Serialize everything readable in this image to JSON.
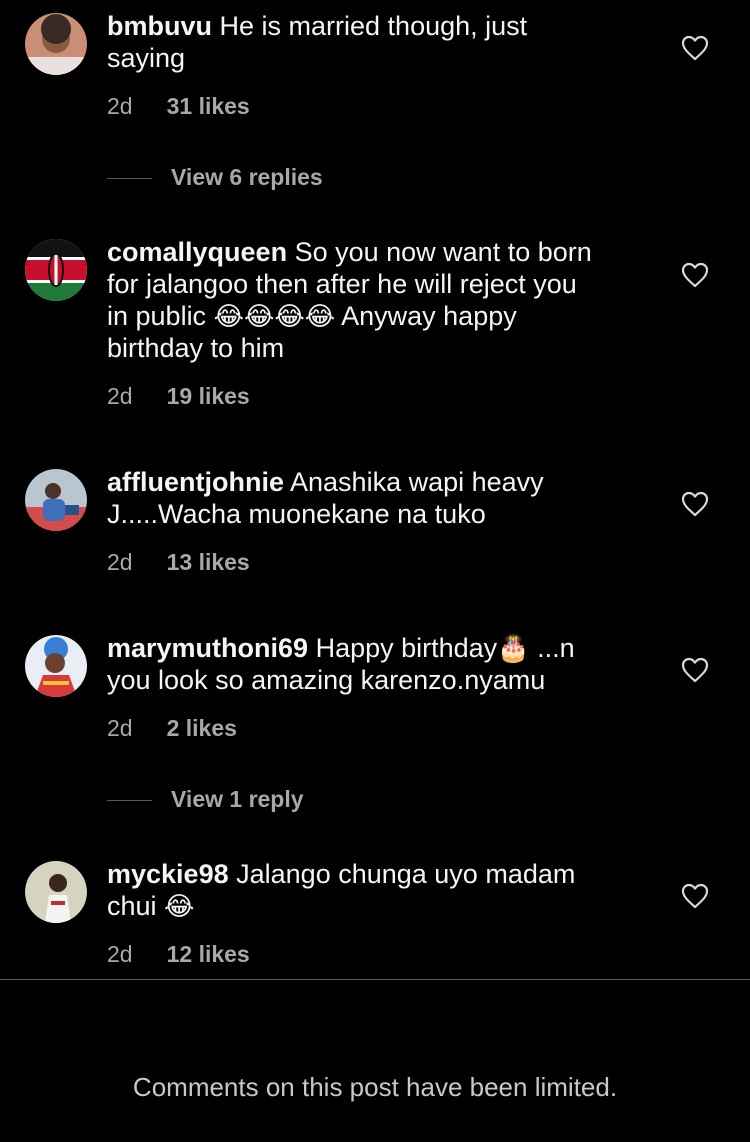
{
  "comments": [
    {
      "username": "bmbuvu",
      "text_lines": [
        "He is married though, just",
        "saying"
      ],
      "time": "2d",
      "likes": "31 likes",
      "replies_label": "View 6 replies"
    },
    {
      "username": "comallyqueen",
      "text_lines": [
        "So you now want to born",
        "for jalangoo then after he will reject you",
        "in public",
        "Anyway happy",
        "birthday to him"
      ],
      "emojis": "😂😂😂😂",
      "time": "2d",
      "likes": "19 likes"
    },
    {
      "username": "affluentjohnie",
      "text_lines": [
        "Anashika wapi heavy",
        "J.....Wacha muonekane na tuko"
      ],
      "time": "2d",
      "likes": "13 likes"
    },
    {
      "username": "marymuthoni69",
      "text_lines": [
        "Happy birthday",
        "...n",
        "you look so amazing karenzo.nyamu"
      ],
      "emojis": "🎂",
      "time": "2d",
      "likes": "2 likes",
      "replies_label": "View 1 reply"
    },
    {
      "username": "myckie98",
      "text_lines": [
        "Jalango chunga uyo madam",
        "chui"
      ],
      "emojis": "😂",
      "time": "2d",
      "likes": "12 likes"
    }
  ],
  "footer_text": "Comments on this post have been limited.",
  "icons": {
    "like": "heart-outline-icon"
  },
  "colors": {
    "background": "#000000",
    "text": "#f5f5f5",
    "meta": "#a8a8a8"
  }
}
